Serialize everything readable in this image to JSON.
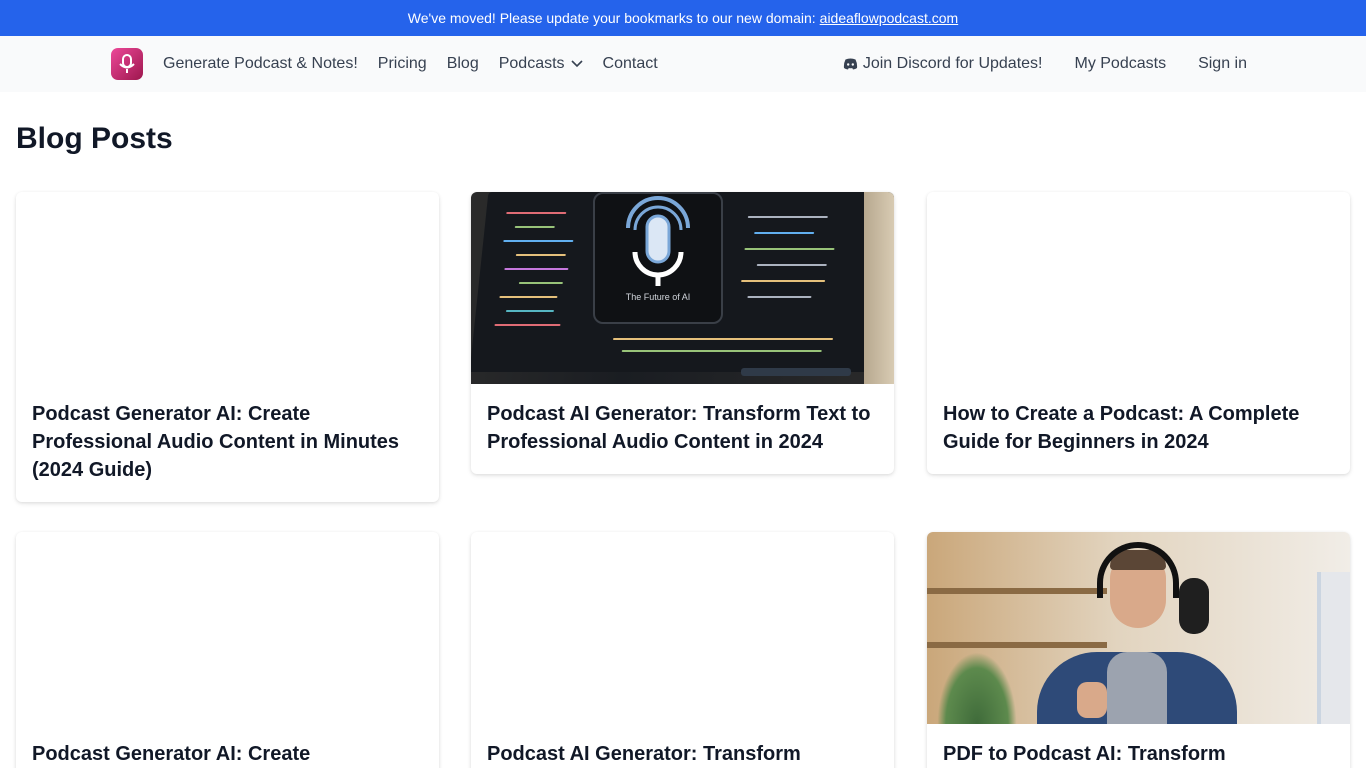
{
  "banner": {
    "text": "We've moved! Please update your bookmarks to our new domain:",
    "link": "aideaflowpodcast.com"
  },
  "nav": {
    "left": [
      "Generate Podcast & Notes!",
      "Pricing",
      "Blog",
      "Podcasts",
      "Contact"
    ],
    "discord": "Join Discord for Updates!",
    "my_podcasts": "My Podcasts",
    "sign_in": "Sign in"
  },
  "page": {
    "title": "Blog Posts"
  },
  "posts": [
    {
      "title": "Podcast Generator AI: Create Professional Audio Content in Minutes (2024 Guide)",
      "image": "none"
    },
    {
      "title": "Podcast AI Generator: Transform Text to Professional Audio Content in 2024",
      "image": "laptop-code-microphone",
      "image_caption": "The Future of AI"
    },
    {
      "title": "How to Create a Podcast: A Complete Guide for Beginners in 2024",
      "image": "none"
    },
    {
      "title": "Podcast Generator AI: Create",
      "image": "none"
    },
    {
      "title": "Podcast AI Generator: Transform",
      "image": "none"
    },
    {
      "title": "PDF to Podcast AI: Transform",
      "image": "podcaster-with-headphones"
    }
  ],
  "colors": {
    "banner": "#2563eb",
    "logo_start": "#ec4899",
    "logo_end": "#9d174d"
  },
  "icons": {
    "logo": "microphone-icon",
    "podcasts_menu": "chevron-down-icon",
    "discord": "discord-icon"
  }
}
